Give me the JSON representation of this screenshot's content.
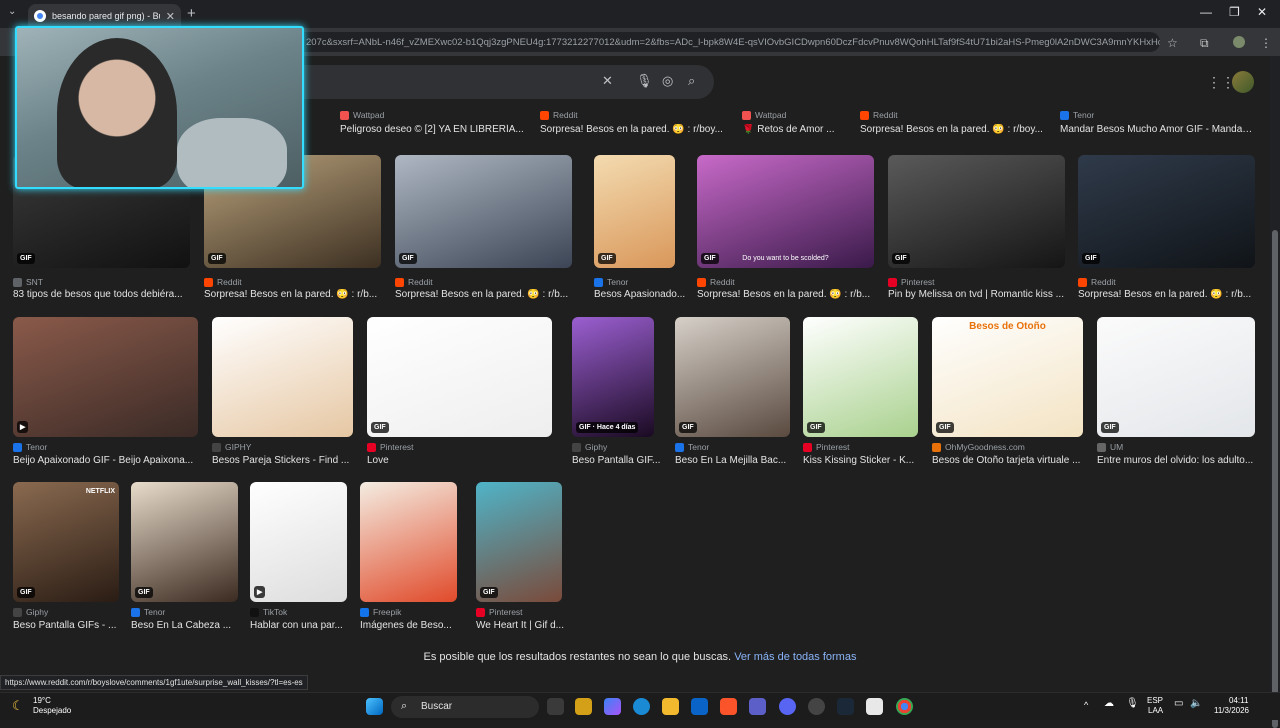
{
  "browser": {
    "tab_title": "besando pared gif png) - Busc",
    "url": "207c&sxsrf=ANbL-n46f_vZMEXwc02-b1Qqj3zgPNEU4g:1773212277012&udm=2&fbs=ADc_l-bpk8W4E-qsVIOvbGICDwpn60DczFdcvPnuv8WQohHLTaf9fS4tU71bi2aHS-Pmeg0lA2nDWC3A9mnYKHxHonOwrj..."
  },
  "row1": [
    {
      "source": "Wattpad",
      "title": "Peligroso deseo © [2] YA EN LIBRERÍA...",
      "color": "#f0534f"
    },
    {
      "source": "Reddit",
      "title": "Sorpresa! Besos en la pared. 😳 : r/boy...",
      "color": "#ff4500"
    },
    {
      "source": "Wattpad",
      "title": "🌹 Retos de Amor ...",
      "color": "#f0534f"
    },
    {
      "source": "Reddit",
      "title": "Sorpresa! Besos en la pared. 😳 : r/boy...",
      "color": "#ff4500"
    },
    {
      "source": "Tenor",
      "title": "Mandar Besos Mucho Amor GIF - Mandar ...",
      "color": "#1a73e8"
    }
  ],
  "row2": [
    {
      "source": "SNT",
      "title": "83 tipos de besos que todos debiéra...",
      "badge": "GIF",
      "color": "#5f6368",
      "c1": "#3a3a3a",
      "c2": "#111"
    },
    {
      "source": "Reddit",
      "title": "Sorpresa! Besos en la pared. 😳 : r/b...",
      "badge": "GIF",
      "color": "#ff4500",
      "c1": "#b9a27c",
      "c2": "#3d3022"
    },
    {
      "source": "Reddit",
      "title": "Sorpresa! Besos en la pared. 😳 : r/b...",
      "badge": "GIF",
      "color": "#ff4500",
      "c1": "#aeb7c2",
      "c2": "#3b4555"
    },
    {
      "source": "Tenor",
      "title": "Besos Apasionado...",
      "badge": "GIF",
      "color": "#1a73e8",
      "c1": "#f3dbb0",
      "c2": "#d9975a"
    },
    {
      "source": "Reddit",
      "title": "Sorpresa! Besos en la pared. 😳 : r/b...",
      "badge": "GIF",
      "overlay": "Do you want to be scolded?",
      "color": "#ff4500",
      "c1": "#c86ac9",
      "c2": "#3a1a4a"
    },
    {
      "source": "Pinterest",
      "title": "Pin by Melissa on tvd | Romantic kiss ...",
      "badge": "GIF",
      "color": "#e60023",
      "c1": "#5a5a5a",
      "c2": "#151515"
    },
    {
      "source": "Reddit",
      "title": "Sorpresa! Besos en la pared. 😳 : r/b...",
      "badge": "GIF",
      "color": "#ff4500",
      "c1": "#2f3a4a",
      "c2": "#101418"
    }
  ],
  "row3": [
    {
      "source": "Tenor",
      "title": "Beijo Apaixonado GIF - Beijo Apaixona...",
      "badge": "▶",
      "color": "#1a73e8",
      "c1": "#8a5a4a",
      "c2": "#3a2a26"
    },
    {
      "source": "GIPHY",
      "title": "Besos Pareja Stickers - Find ...",
      "badge": "",
      "color": "#444",
      "c1": "#fff",
      "c2": "#e6c7a3"
    },
    {
      "source": "Pinterest",
      "title": "Love",
      "badge": "GIF",
      "color": "#e60023",
      "c1": "#fff",
      "c2": "#eee"
    },
    {
      "source": "Giphy",
      "title": "Beso Pantalla GIF...",
      "badge": "GIF · Hace 4 días",
      "color": "#444",
      "c1": "#9b5fd1",
      "c2": "#1a0a22"
    },
    {
      "source": "Tenor",
      "title": "Beso En La Mejilla Bac...",
      "badge": "GIF",
      "color": "#1a73e8",
      "c1": "#d6d0c8",
      "c2": "#5a4a40"
    },
    {
      "source": "Pinterest",
      "title": "Kiss Kissing Sticker - K...",
      "badge": "GIF",
      "color": "#e60023",
      "c1": "#fff",
      "c2": "#a9d18e"
    },
    {
      "source": "OhMyGoodness.com",
      "title": "Besos de Otoño tarjeta virtuale ...",
      "badge": "GIF",
      "overlay": "Besos de Otoño",
      "color": "#e8710a",
      "c1": "#fff",
      "c2": "#f3e3c3"
    },
    {
      "source": "UM",
      "title": "Entre muros del olvido: los adulto...",
      "badge": "GIF",
      "color": "#666",
      "c1": "#fbfbfb",
      "c2": "#e3e6ea"
    }
  ],
  "row4": [
    {
      "source": "Giphy",
      "title": "Beso Pantalla GIFs - ...",
      "badge": "GIF",
      "overlay": "NETFLIX",
      "color": "#444",
      "c1": "#8a6a50",
      "c2": "#2a1c14"
    },
    {
      "source": "Tenor",
      "title": "Beso En La Cabeza ...",
      "badge": "GIF",
      "color": "#1a73e8",
      "c1": "#e8dccb",
      "c2": "#3b2a20"
    },
    {
      "source": "TikTok",
      "title": "Hablar con una par...",
      "badge": "▶",
      "color": "#111",
      "c1": "#fff",
      "c2": "#ddd"
    },
    {
      "source": "Freepik",
      "title": "Imágenes de Beso...",
      "badge": "",
      "color": "#1273eb",
      "c1": "#f4ede2",
      "c2": "#e04a2a"
    },
    {
      "source": "Pinterest",
      "title": "We Heart It | Gif d...",
      "badge": "GIF",
      "color": "#e60023",
      "c1": "#4fb4c8",
      "c2": "#7a4a3a"
    }
  ],
  "more": {
    "text": "Es posible que los resultados restantes no sean lo que buscas.",
    "link": "Ver más de todas formas"
  },
  "status_url": "https://www.reddit.com/r/boyslove/comments/1gf1ute/surprise_wall_kisses/?tl=es-es",
  "taskbar": {
    "temp": "19°C",
    "weather": "Despejado",
    "search": "Buscar",
    "lang1": "ESP",
    "lang2": "LAA",
    "time": "04:11",
    "date": "11/3/2026"
  }
}
